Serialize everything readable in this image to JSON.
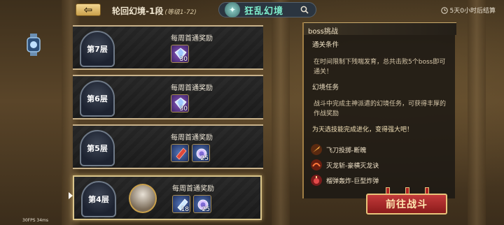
{
  "header": {
    "back_icon": "back-arrow-icon",
    "stage_title": "轮回幻境-1段",
    "stage_level_range": "(等级1-72)",
    "mode_label": "狂乱幻境",
    "search_icon": "search-icon",
    "reset_text": "5天0小时后结算"
  },
  "floors": [
    {
      "label": "第7层",
      "reward_title": "每周首通奖励",
      "rewards": [
        {
          "icon": "purple-diamond-icon",
          "count": "30"
        }
      ]
    },
    {
      "label": "第6层",
      "reward_title": "每周首通奖励",
      "rewards": [
        {
          "icon": "purple-diamond-icon",
          "count": "30"
        }
      ]
    },
    {
      "label": "第5层",
      "reward_title": "每周首通奖励",
      "rewards": [
        {
          "icon": "red-crystal-icon",
          "count": ""
        },
        {
          "icon": "blue-orb-icon",
          "count": "25"
        }
      ]
    },
    {
      "label": "第4层",
      "reward_title": "每周首通奖励",
      "rewards": [
        {
          "icon": "blue-crystal-icon",
          "count": "18"
        },
        {
          "icon": "blue-orb-icon",
          "count": "25"
        }
      ],
      "current": true
    }
  ],
  "panel": {
    "title": "boss挑战",
    "clear_condition_heading": "通关条件",
    "clear_condition_text": "在时间限制下残喘发育，总共击败5个boss即可通关！",
    "mission_heading": "幻境任务",
    "mission_text": "战斗中完成主神派遣的幻境任务，可获得丰厚的作战奖励",
    "evolve_text": "为天选技能完成进化，变得强大吧！",
    "skills": [
      {
        "icon": "flying-knife-icon",
        "name": "飞刀投掷-断魄"
      },
      {
        "icon": "dragon-slash-icon",
        "name": "灭龙斩-豪横灭龙诀"
      },
      {
        "icon": "bomb-icon",
        "name": "榴弹轰炸-巨型炸弹"
      }
    ]
  },
  "go_button": "前往战斗",
  "fps": "30FPS   34ms"
}
